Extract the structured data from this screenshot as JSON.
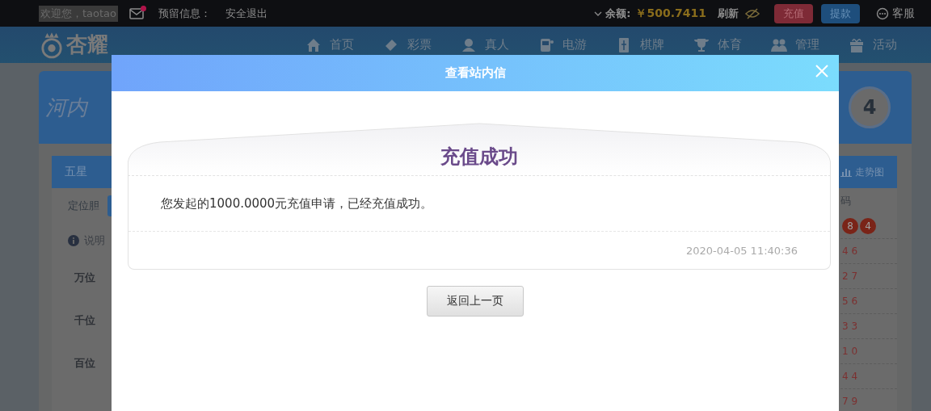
{
  "top_bar": {
    "greeting": "欢迎您，taotao",
    "mail_unread": true,
    "reserved_info_label": "预留信息：",
    "logout": "安全退出",
    "balance_label": "余额:",
    "balance": "￥500.7411",
    "refresh": "刷新",
    "deposit": "充值",
    "withdraw": "提款",
    "support": "客服"
  },
  "nav": {
    "logo": "杏耀",
    "items": [
      {
        "label": "首页"
      },
      {
        "label": "彩票"
      },
      {
        "label": "真人"
      },
      {
        "label": "电游"
      },
      {
        "label": "棋牌"
      },
      {
        "label": "体育"
      },
      {
        "label": "管理"
      },
      {
        "label": "活动"
      }
    ]
  },
  "game": {
    "logo": "河内",
    "ball": "4",
    "tab": "五星",
    "trend": "走势图",
    "play_label": "定位胆",
    "info": "说明",
    "positions": [
      "万位",
      "千位",
      "百位"
    ],
    "history_header": "码",
    "latest": [
      "8",
      "4"
    ],
    "history": [
      "4 6",
      "2 7",
      "5 6",
      "3 3",
      "1 0",
      "4 4",
      "7 9"
    ]
  },
  "modal": {
    "title": "查看站内信",
    "heading": "充值成功",
    "message": "您发起的1000.0000元充值申请，已经充值成功。",
    "time": "2020-04-05 11:40:36",
    "back_button": "返回上一页"
  }
}
